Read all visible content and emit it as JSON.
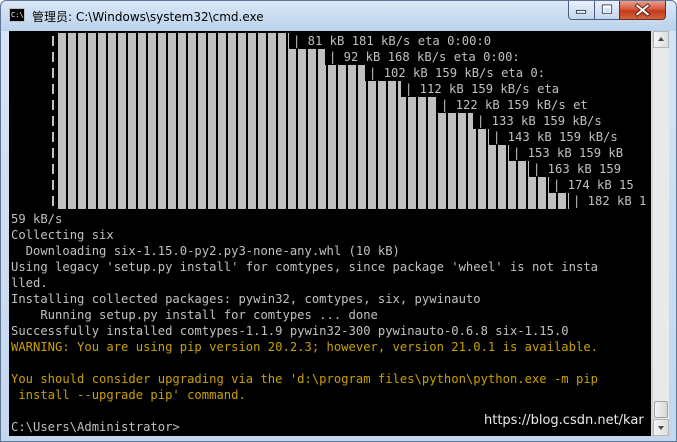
{
  "window": {
    "title": "管理员: C:\\Windows\\system32\\cmd.exe",
    "icon_label": "C:\\"
  },
  "console": {
    "progress_lines": [
      "| 81 kB 181 kB/s eta 0:00:0",
      "| 92 kB 168 kB/s eta 0:00:",
      "| 102 kB 159 kB/s eta 0:",
      "| 112 kB 159 kB/s eta",
      "| 122 kB 159 kB/s et",
      "| 133 kB 159 kB/s",
      "| 143 kB 159 kB/s",
      "| 153 kB 159 kB",
      "| 163 kB 159",
      "| 174 kB 15",
      "| 182 kB 1"
    ],
    "output_lines": [
      {
        "text": "59 kB/s",
        "style": "normal"
      },
      {
        "text": "Collecting six",
        "style": "normal"
      },
      {
        "text": "  Downloading six-1.15.0-py2.py3-none-any.whl (10 kB)",
        "style": "normal"
      },
      {
        "text": "Using legacy 'setup.py install' for comtypes, since package 'wheel' is not insta",
        "style": "normal"
      },
      {
        "text": "lled.",
        "style": "normal"
      },
      {
        "text": "Installing collected packages: pywin32, comtypes, six, pywinauto",
        "style": "normal"
      },
      {
        "text": "    Running setup.py install for comtypes ... done",
        "style": "normal"
      },
      {
        "text": "Successfully installed comtypes-1.1.9 pywin32-300 pywinauto-0.6.8 six-1.15.0",
        "style": "normal"
      },
      {
        "text": "WARNING: You are using pip version 20.2.3; however, version 21.0.1 is available.",
        "style": "warning"
      },
      {
        "text": "",
        "style": "normal"
      },
      {
        "text": "You should consider upgrading via the 'd:\\program files\\python\\python.exe -m pip",
        "style": "warning"
      },
      {
        "text": " install --upgrade pip' command.",
        "style": "warning"
      },
      {
        "text": "",
        "style": "normal"
      },
      {
        "text": "C:\\Users\\Administrator>",
        "style": "normal"
      }
    ]
  },
  "watermark": "https://blog.csdn.net/kar",
  "colors": {
    "console_bg": "#000000",
    "console_text": "#c0c0c0",
    "warning_text": "#c8a000"
  },
  "icons": {
    "app": "cmd-console-icon",
    "minimize": "minimize-icon",
    "maximize": "maximize-icon",
    "close": "close-icon",
    "scroll_up": "chevron-up-icon",
    "scroll_down": "chevron-down-icon"
  }
}
